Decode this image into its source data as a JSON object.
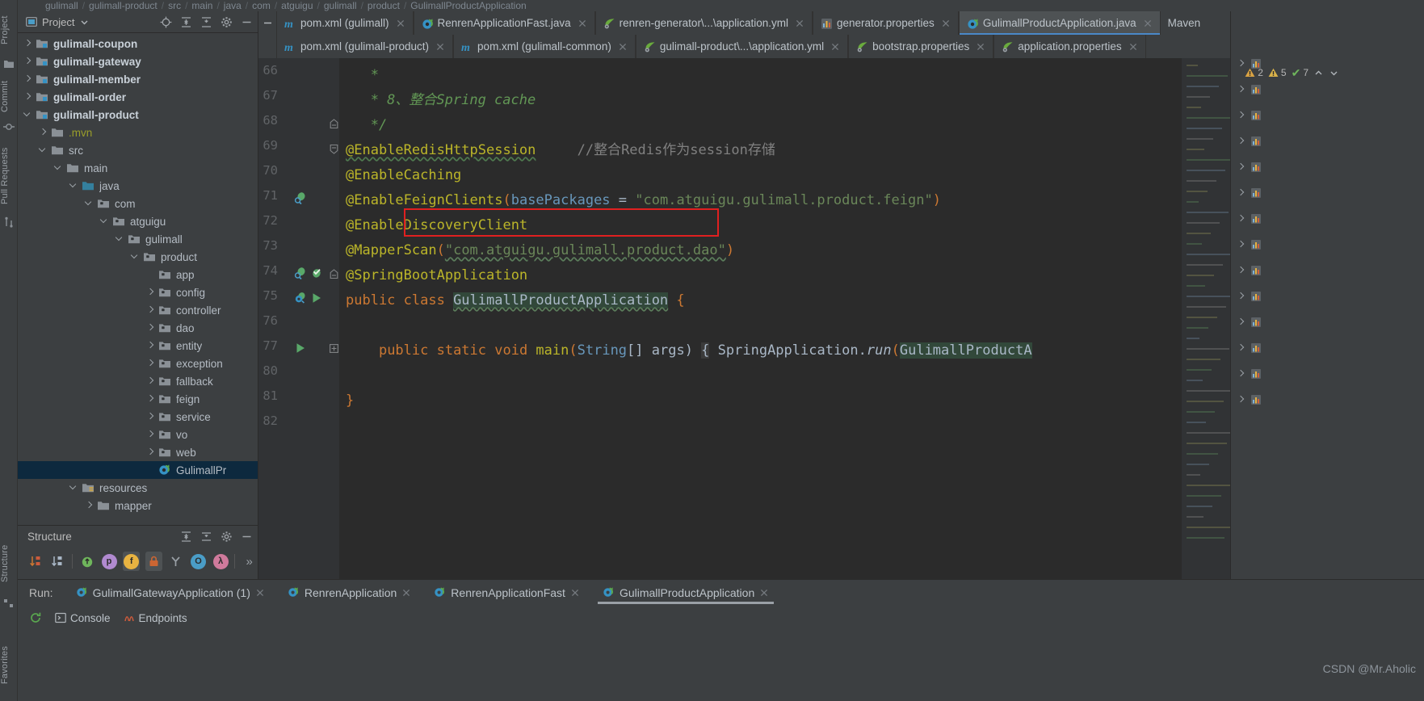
{
  "breadcrumb": {
    "items": [
      "gulimall",
      "gulimall-product",
      "src",
      "main",
      "java",
      "com",
      "atguigu",
      "gulimall",
      "product",
      "GulimallProductApplication"
    ],
    "separator": "/"
  },
  "left_strip": {
    "tabs": [
      "Project",
      "Commit",
      "Pull Requests",
      "Structure",
      "Favorites"
    ]
  },
  "project_panel": {
    "title": "Project",
    "dropdown_icon": "chevron-down-icon",
    "header_icons": [
      "locate-icon",
      "expand-all-icon",
      "collapse-all-icon",
      "gear-icon",
      "hide-icon"
    ],
    "tree": [
      {
        "label": "gulimall-coupon",
        "indent": 1,
        "arrow": "closed",
        "icon": "module-folder",
        "bold": true
      },
      {
        "label": "gulimall-gateway",
        "indent": 1,
        "arrow": "closed",
        "icon": "module-folder",
        "bold": true
      },
      {
        "label": "gulimall-member",
        "indent": 1,
        "arrow": "closed",
        "icon": "module-folder",
        "bold": true
      },
      {
        "label": "gulimall-order",
        "indent": 1,
        "arrow": "closed",
        "icon": "module-folder",
        "bold": true
      },
      {
        "label": "gulimall-product",
        "indent": 1,
        "arrow": "open",
        "icon": "module-folder",
        "bold": true
      },
      {
        "label": ".mvn",
        "indent": 2,
        "arrow": "closed",
        "icon": "folder",
        "olive": true
      },
      {
        "label": "src",
        "indent": 2,
        "arrow": "open",
        "icon": "folder"
      },
      {
        "label": "main",
        "indent": 3,
        "arrow": "open",
        "icon": "folder"
      },
      {
        "label": "java",
        "indent": 4,
        "arrow": "open",
        "icon": "source-folder"
      },
      {
        "label": "com",
        "indent": 5,
        "arrow": "open",
        "icon": "package"
      },
      {
        "label": "atguigu",
        "indent": 6,
        "arrow": "open",
        "icon": "package"
      },
      {
        "label": "gulimall",
        "indent": 7,
        "arrow": "open",
        "icon": "package"
      },
      {
        "label": "product",
        "indent": 8,
        "arrow": "open",
        "icon": "package"
      },
      {
        "label": "app",
        "indent": 9,
        "arrow": "none",
        "icon": "package"
      },
      {
        "label": "config",
        "indent": 9,
        "arrow": "closed",
        "icon": "package"
      },
      {
        "label": "controller",
        "indent": 9,
        "arrow": "closed",
        "icon": "package"
      },
      {
        "label": "dao",
        "indent": 9,
        "arrow": "closed",
        "icon": "package"
      },
      {
        "label": "entity",
        "indent": 9,
        "arrow": "closed",
        "icon": "package"
      },
      {
        "label": "exception",
        "indent": 9,
        "arrow": "closed",
        "icon": "package"
      },
      {
        "label": "fallback",
        "indent": 9,
        "arrow": "closed",
        "icon": "package"
      },
      {
        "label": "feign",
        "indent": 9,
        "arrow": "closed",
        "icon": "package"
      },
      {
        "label": "service",
        "indent": 9,
        "arrow": "closed",
        "icon": "package"
      },
      {
        "label": "vo",
        "indent": 9,
        "arrow": "closed",
        "icon": "package"
      },
      {
        "label": "web",
        "indent": 9,
        "arrow": "closed",
        "icon": "package"
      },
      {
        "label": "GulimallPr",
        "indent": 9,
        "arrow": "none",
        "icon": "spring-class",
        "selected": true
      },
      {
        "label": "resources",
        "indent": 4,
        "arrow": "open",
        "icon": "resources-folder"
      },
      {
        "label": "mapper",
        "indent": 5,
        "arrow": "closed",
        "icon": "folder"
      }
    ]
  },
  "editor_tabs": {
    "row1": [
      {
        "label": "pom.xml (gulimall)",
        "icon": "maven-m-icon",
        "active": false,
        "closable": true
      },
      {
        "label": "RenrenApplicationFast.java",
        "icon": "spring-class-icon",
        "active": false,
        "closable": true
      },
      {
        "label": "renren-generator\\...\\application.yml",
        "icon": "spring-leaf-icon",
        "active": false,
        "closable": true
      },
      {
        "label": "generator.properties",
        "icon": "properties-icon",
        "active": false,
        "closable": true
      },
      {
        "label": "GulimallProductApplication.java",
        "icon": "spring-class-icon",
        "active": true,
        "closable": true
      }
    ],
    "row2": [
      {
        "label": "pom.xml (gulimall-product)",
        "icon": "maven-m-icon",
        "active": false,
        "closable": true
      },
      {
        "label": "pom.xml (gulimall-common)",
        "icon": "maven-m-icon",
        "active": false,
        "closable": true
      },
      {
        "label": "gulimall-product\\...\\application.yml",
        "icon": "spring-leaf-icon",
        "active": false,
        "closable": true
      },
      {
        "label": "bootstrap.properties",
        "icon": "spring-leaf-icon",
        "active": false,
        "closable": true
      },
      {
        "label": "application.properties",
        "icon": "spring-leaf-icon",
        "active": false,
        "closable": true
      }
    ],
    "right_label": "Maven"
  },
  "inspections": {
    "warnings": "2",
    "weak_warnings": "5",
    "checks": "7",
    "warning_icon": "warning-triangle-icon",
    "weak_warning_icon": "weak-warning-triangle-icon",
    "ok_icon": "checkmark-icon",
    "up_icon": "chevron-up-icon",
    "down_icon": "chevron-down-icon"
  },
  "code": {
    "lines": [
      {
        "num": "66",
        "segments": [
          {
            "t": "   *",
            "c": "cmt"
          }
        ]
      },
      {
        "num": "67",
        "segments": [
          {
            "t": "   * 8、整合Spring cache",
            "c": "cmt"
          }
        ]
      },
      {
        "num": "68",
        "segments": [
          {
            "t": "   */",
            "c": "cmt"
          }
        ],
        "fold": "end"
      },
      {
        "num": "69",
        "segments": [
          {
            "t": "@EnableRedisHttpSession",
            "c": "anno wavy"
          },
          {
            "t": "     ",
            "c": "pln"
          },
          {
            "t": "//整合Redis作为session存储",
            "c": "lcmt"
          }
        ],
        "fold": "start"
      },
      {
        "num": "70",
        "segments": [
          {
            "t": "@EnableCaching",
            "c": "anno"
          }
        ]
      },
      {
        "num": "71",
        "segments": [
          {
            "t": "@EnableFeignClients",
            "c": "anno"
          },
          {
            "t": "(",
            "c": "kw"
          },
          {
            "t": "basePackages",
            "c": "num"
          },
          {
            "t": " = ",
            "c": "pln"
          },
          {
            "t": "\"com.atguigu.gulimall.product.feign\"",
            "c": "str"
          },
          {
            "t": ")",
            "c": "kw"
          }
        ],
        "gutter": [
          "bean-icon"
        ]
      },
      {
        "num": "72",
        "segments": [
          {
            "t": "@EnableDiscoveryClient",
            "c": "anno"
          }
        ],
        "highlighted": true
      },
      {
        "num": "73",
        "segments": [
          {
            "t": "@MapperScan",
            "c": "anno"
          },
          {
            "t": "(",
            "c": "kw"
          },
          {
            "t": "\"com.atguigu.gulimall.product.dao\"",
            "c": "str wavy-g"
          },
          {
            "t": ")",
            "c": "kw"
          }
        ]
      },
      {
        "num": "74",
        "segments": [
          {
            "t": "@SpringBootApplication",
            "c": "anno"
          }
        ],
        "gutter": [
          "bean-icon",
          "spring-check-icon"
        ],
        "fold": "end2"
      },
      {
        "num": "75",
        "segments": [
          {
            "t": "public class ",
            "c": "kw"
          },
          {
            "t": "GulimallProductApplication",
            "c": "pln cls-hl wavy-g"
          },
          {
            "t": " {",
            "c": "kw"
          }
        ],
        "gutter": [
          "spring-bean-icon",
          "run-icon"
        ]
      },
      {
        "num": "76",
        "segments": [
          {
            "t": "",
            "c": "pln"
          }
        ]
      },
      {
        "num": "77",
        "segments": [
          {
            "t": "    ",
            "c": "pln"
          },
          {
            "t": "public static void ",
            "c": "kw"
          },
          {
            "t": "main",
            "c": "anno"
          },
          {
            "t": "(",
            "c": "kw"
          },
          {
            "t": "String",
            "c": "num"
          },
          {
            "t": "[] args) ",
            "c": "pln"
          },
          {
            "t": "{",
            "c": "fld"
          },
          {
            "t": " SpringApplication.",
            "c": "pln"
          },
          {
            "t": "run",
            "c": "pln ital"
          },
          {
            "t": "(",
            "c": "kw"
          },
          {
            "t": "GulimallProductA",
            "c": "pln cls-hl"
          }
        ],
        "gutter": [
          "run-icon"
        ],
        "fold": "collapsed"
      },
      {
        "num": "80",
        "segments": [
          {
            "t": "",
            "c": "pln"
          }
        ]
      },
      {
        "num": "81",
        "segments": [
          {
            "t": "}",
            "c": "kw"
          }
        ]
      },
      {
        "num": "82",
        "segments": [
          {
            "t": "",
            "c": "pln"
          }
        ]
      }
    ],
    "annotation_box_color": "#e02020"
  },
  "maven_panel": {
    "title": "Maven",
    "rows": 14
  },
  "structure_panel": {
    "title": "Structure",
    "header_icons": [
      "expand-all-icon",
      "collapse-all-icon",
      "gear-icon",
      "hide-icon"
    ],
    "toolbar_icons": [
      {
        "name": "sort-by-visibility-icon",
        "glyph": "↓",
        "color": "#cc7832"
      },
      {
        "name": "sort-alphabetically-icon",
        "glyph": "↓",
        "color": "#a9b7c6"
      },
      {
        "name": "show-inherited-icon",
        "glyph": "↑",
        "color": "#6fb65c"
      },
      {
        "name": "show-properties-icon",
        "glyph": "p",
        "color": "#b18ad0"
      },
      {
        "name": "show-fields-icon",
        "glyph": "f",
        "color": "#e8b341",
        "active": true
      },
      {
        "name": "show-non-public-icon",
        "glyph": "",
        "color": "#cc6633",
        "active": true
      },
      {
        "name": "group-methods-icon",
        "glyph": "Y",
        "color": "#9aa0a6"
      },
      {
        "name": "show-anonymous-icon",
        "glyph": "O",
        "color": "#4a9dc7"
      },
      {
        "name": "show-lambdas-icon",
        "glyph": "λ",
        "color": "#d07a9c"
      },
      {
        "name": "more-icon",
        "glyph": "»",
        "color": "#9aa0a6"
      }
    ]
  },
  "run_panel": {
    "label": "Run:",
    "tabs": [
      {
        "label": "GulimallGatewayApplication (1)",
        "icon": "spring-run-icon",
        "active": false,
        "closable": true
      },
      {
        "label": "RenrenApplication",
        "icon": "spring-run-icon",
        "active": false,
        "closable": true
      },
      {
        "label": "RenrenApplicationFast",
        "icon": "spring-run-icon",
        "active": false,
        "closable": true
      },
      {
        "label": "GulimallProductApplication",
        "icon": "spring-run-icon",
        "active": true,
        "closable": true
      }
    ],
    "sub_tabs": [
      {
        "label": "Console",
        "icon": "console-icon"
      },
      {
        "label": "Endpoints",
        "icon": "endpoints-icon"
      }
    ],
    "rerun_icon": "rerun-icon"
  },
  "watermark": "CSDN @Mr.Aholic",
  "colors": {
    "editor_bg": "#2b2b2b",
    "panel_bg": "#3c3f41",
    "gutter_bg": "#313335",
    "selection_blue": "#0d293e",
    "tab_active": "#4e5254",
    "accent_blue": "#4a88c7",
    "annotation_red": "#e02020",
    "annotation_text": "#bbb529"
  }
}
